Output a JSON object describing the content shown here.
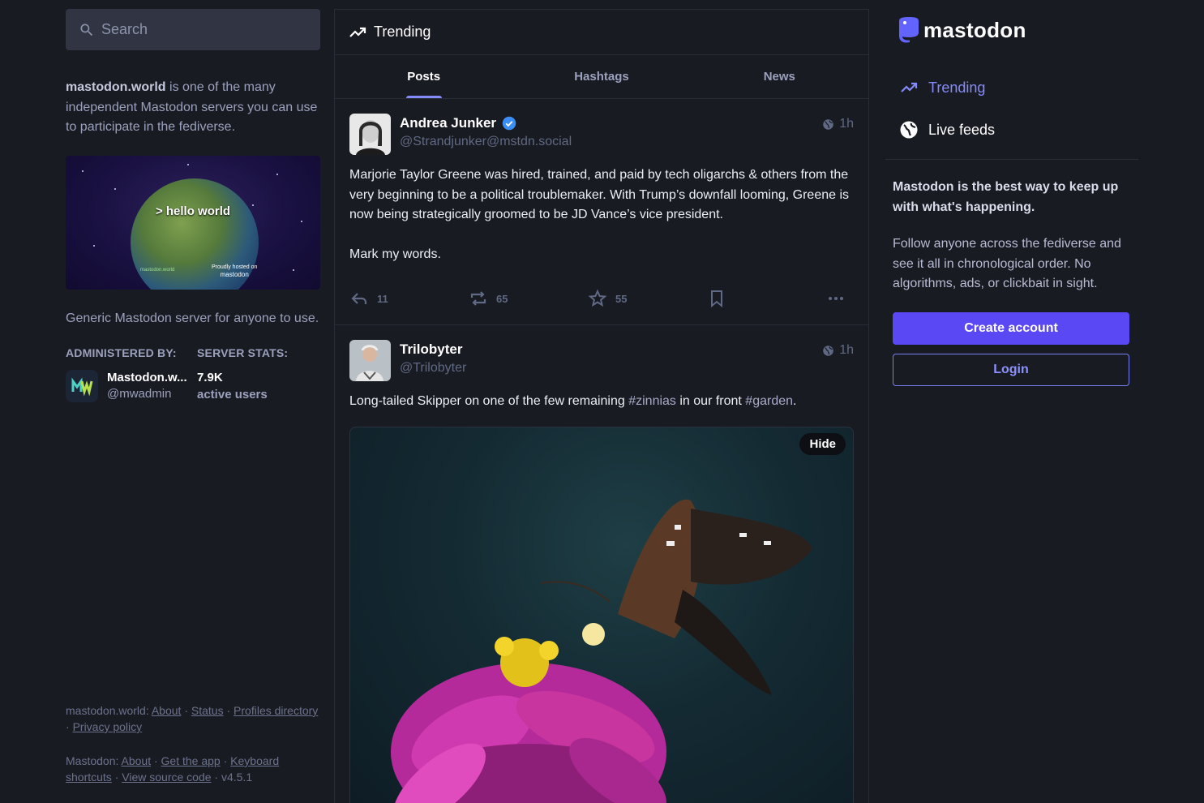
{
  "search": {
    "placeholder": "Search"
  },
  "server": {
    "domain": "mastodon.world",
    "intro_rest": " is one of the many independent Mastodon servers you can use to participate in the fediverse.",
    "hero_text": "> hello world",
    "hero_hosted": "Proudly hosted on",
    "hero_hosted_brand": "mastodon",
    "hero_server": "mastodon.world",
    "description": "Generic Mastodon server for anyone to use.",
    "administered_by_label": "ADMINISTERED BY:",
    "server_stats_label": "SERVER STATS:",
    "admin_name": "Mastodon.w...",
    "admin_handle": "@mwadmin",
    "active_users_value": "7.9K",
    "active_users_label": "active users"
  },
  "footer": {
    "server_prefix": "mastodon.world",
    "server_links": [
      "About",
      "Status",
      "Profiles directory",
      "Privacy policy"
    ],
    "mastodon_prefix": "Mastodon",
    "mastodon_links": [
      "About",
      "Get the app",
      "Keyboard shortcuts",
      "View source code"
    ],
    "version": "v4.5.1"
  },
  "column": {
    "title": "Trending",
    "tabs": [
      {
        "label": "Posts",
        "active": true
      },
      {
        "label": "Hashtags",
        "active": false
      },
      {
        "label": "News",
        "active": false
      }
    ]
  },
  "posts": [
    {
      "display_name": "Andrea Junker",
      "verified": true,
      "handle": "@Strandjunker@mstdn.social",
      "time": "1h",
      "paragraphs": [
        "Marjorie Taylor Greene was hired, trained, and paid by tech oligarchs & others from the very beginning to be a political troublemaker. With Trump’s downfall looming, Greene is now being strategically groomed to be JD Vance’s vice president.",
        "Mark my words."
      ],
      "replies": "11",
      "boosts": "65",
      "favourites": "55"
    },
    {
      "display_name": "Trilobyter",
      "handle": "@Trilobyter",
      "time": "1h",
      "text_before": "Long-tailed Skipper on one of the few remaining ",
      "hashtag1": "#zinnias",
      "text_middle": " in our front ",
      "hashtag2": "#garden",
      "text_after": ".",
      "media_hide_label": "Hide"
    }
  ],
  "right": {
    "logo_text": "mastodon",
    "nav": [
      {
        "label": "Trending",
        "active": true
      },
      {
        "label": "Live feeds",
        "active": false
      }
    ],
    "promo_heading": "Mastodon is the best way to keep up with what's happening.",
    "promo_text": "Follow anyone across the fediverse and see it all in chronological order. No algorithms, ads, or clickbait in sight.",
    "create_account": "Create account",
    "login": "Login"
  },
  "colors": {
    "background": "#191b22",
    "accent": "#858afa",
    "primary_button": "#5b48f5",
    "muted_text": "#606984"
  }
}
